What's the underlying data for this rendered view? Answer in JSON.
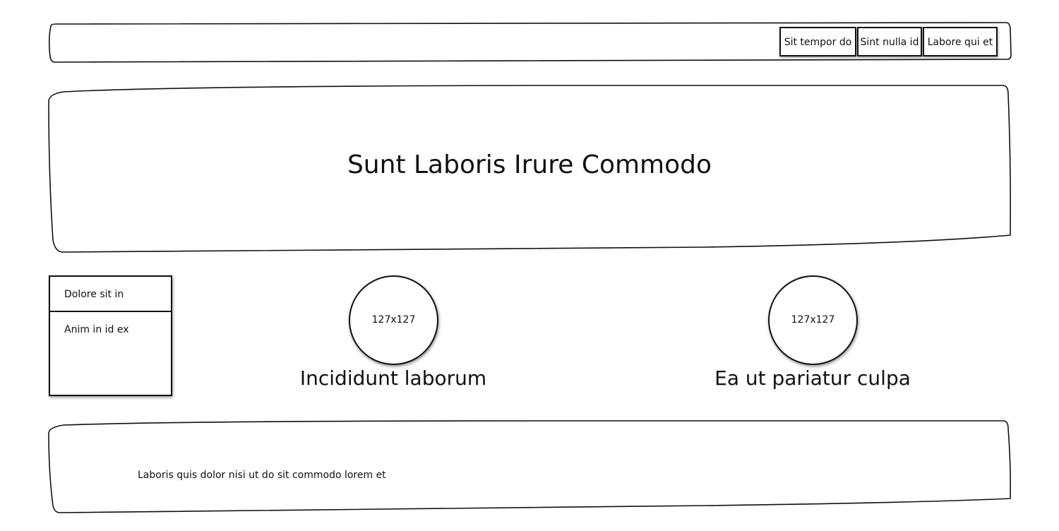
{
  "nav": {
    "items": [
      {
        "label": "Sit tempor do"
      },
      {
        "label": "Sint nulla id"
      },
      {
        "label": "Labore qui et"
      }
    ]
  },
  "hero": {
    "title": "Sunt Laboris Irure Commodo"
  },
  "side_menu": {
    "items": [
      {
        "label": "Dolore sit in"
      },
      {
        "label": "Anim in id ex"
      }
    ]
  },
  "features": [
    {
      "image_label": "127x127",
      "caption": "Incididunt laborum"
    },
    {
      "image_label": "127x127",
      "caption": "Ea ut pariatur culpa"
    }
  ],
  "footer": {
    "text": "Laboris quis dolor nisi ut do sit commodo lorem et"
  }
}
